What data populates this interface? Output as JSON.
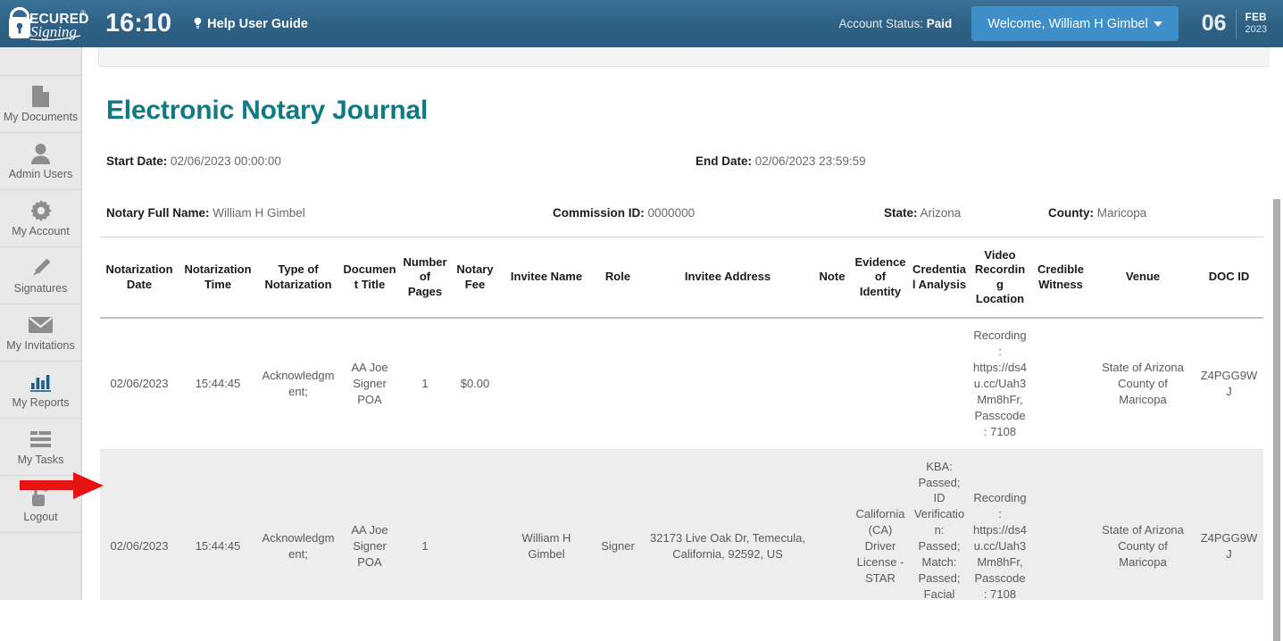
{
  "header": {
    "logo_text_top": "SECURED",
    "logo_text_bottom": "Signing",
    "logo_reg_mark": "®",
    "clock": "16:10",
    "help_label": "Help User Guide",
    "help_icon": "lightbulb-icon",
    "account_status_label": "Account Status:",
    "account_status_value": "Paid",
    "welcome_label": "Welcome, William H Gimbel",
    "welcome_caret_icon": "caret-down-icon",
    "date_day": "06",
    "date_month": "FEB",
    "date_year": "2023",
    "bg_color": "#2e6185",
    "welcome_btn_color": "#3d8ec9"
  },
  "sidebar": {
    "items": [
      {
        "label": "My Documents",
        "icon": "document-icon",
        "active": false
      },
      {
        "label": "Admin Users",
        "icon": "user-icon",
        "active": false
      },
      {
        "label": "My Account",
        "icon": "gear-icon",
        "active": false
      },
      {
        "label": "Signatures",
        "icon": "pencil-icon",
        "active": false
      },
      {
        "label": "My Invitations",
        "icon": "envelope-icon",
        "active": false
      },
      {
        "label": "My Reports",
        "icon": "bar-chart-icon",
        "active": true
      },
      {
        "label": "My Tasks",
        "icon": "tasks-list-icon",
        "active": false
      },
      {
        "label": "Logout",
        "icon": "open-padlock-icon",
        "active": false
      }
    ]
  },
  "main": {
    "title": "Electronic Notary Journal",
    "title_color": "#107a84",
    "meta": {
      "start_date_label": "Start Date:",
      "start_date_value": "02/06/2023 00:00:00",
      "end_date_label": "End Date:",
      "end_date_value": "02/06/2023 23:59:59",
      "notary_name_label": "Notary Full Name:",
      "notary_name_value": "William H Gimbel",
      "commission_id_label": "Commission ID:",
      "commission_id_value": "0000000",
      "state_label": "State:",
      "state_value": "Arizona",
      "county_label": "County:",
      "county_value": "Maricopa"
    },
    "table": {
      "columns": [
        "Notarization Date",
        "Notarization Time",
        "Type of Notarization",
        "Document Title",
        "Number of Pages",
        "Notary Fee",
        "Invitee Name",
        "Role",
        "Invitee Address",
        "Note",
        "Evidence of Identity",
        "Credential Analysis",
        "Video Recording Location",
        "Credible Witness",
        "Venue",
        "DOC ID"
      ],
      "rows": [
        {
          "notarization_date": "02/06/2023",
          "notarization_time": "15:44:45",
          "type_of_notarization": "Acknowledgment;",
          "document_title": "AA Joe Signer POA",
          "number_of_pages": "1",
          "notary_fee": "$0.00",
          "invitee_name": "",
          "role": "",
          "invitee_address": "",
          "note": "",
          "evidence_of_identity": "",
          "credential_analysis": "",
          "video_recording_location": "Recording: https://ds4u.cc/Uah3Mm8hFr, Passcode: 7108",
          "credible_witness": "",
          "venue": "State of Arizona County of Maricopa",
          "doc_id": "Z4PGG9WJ"
        },
        {
          "notarization_date": "02/06/2023",
          "notarization_time": "15:44:45",
          "type_of_notarization": "Acknowledgment;",
          "document_title": "AA Joe Signer POA",
          "number_of_pages": "1",
          "notary_fee": "",
          "invitee_name": "William H Gimbel",
          "role": "Signer",
          "invitee_address": "32173 Live Oak Dr, Temecula, California, 92592, US",
          "note": "",
          "evidence_of_identity": "California (CA) Driver License - STAR",
          "credential_analysis": "KBA: Passed; ID Verification: Passed; Match: Passed; Facial Match: Passed",
          "video_recording_location": "Recording: https://ds4u.cc/Uah3Mm8hFr, Passcode: 7108",
          "credible_witness": "",
          "venue": "State of Arizona County of Maricopa",
          "doc_id": "Z4PGG9WJ"
        }
      ]
    }
  },
  "annotation": {
    "arrow_color": "#e81313",
    "arrow_name": "red-pointer-arrow"
  }
}
